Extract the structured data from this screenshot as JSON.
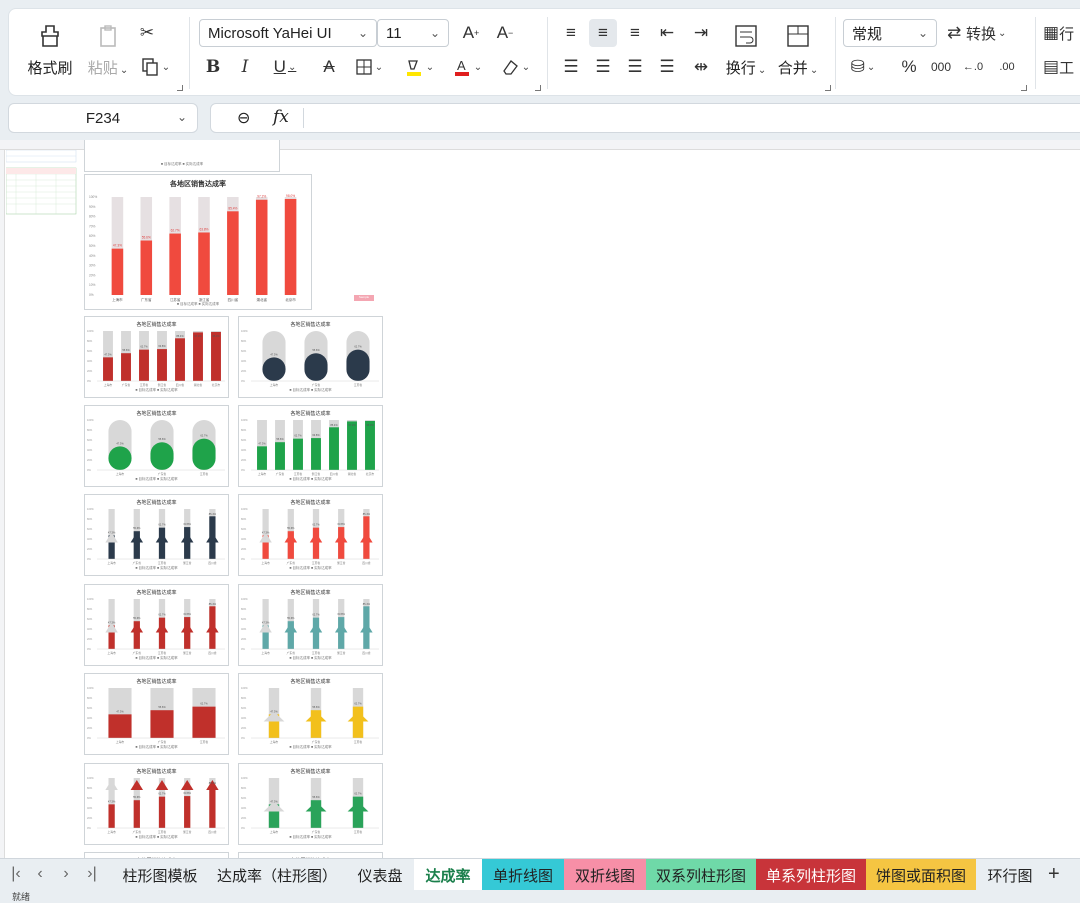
{
  "ribbon": {
    "format_painter": "格式刷",
    "paste": "粘贴",
    "font_name": "Microsoft YaHei UI",
    "font_size": "11",
    "wrap": "换行",
    "merge": "合并",
    "number_format": "常规",
    "convert": "转换",
    "row_col_partial": "行",
    "work_partial": "工",
    "percent_symbol": "%",
    "thousands_symbol": "000"
  },
  "formula_bar": {
    "cell_ref": "F234",
    "fx": "fx",
    "content": ""
  },
  "sheet": {
    "pink_chip": "Sample",
    "big_chart_title": "各地区销售达成率",
    "small_chart_title": "各地区销售达成率",
    "legend_text": "■ 目标达成率 ■ 实际达成率",
    "big_categories": [
      "上海市",
      "广东省",
      "江苏省",
      "浙江省",
      "四川省",
      "湖北省",
      "北京市"
    ],
    "big_values": [
      47.3,
      55.6,
      62.7,
      63.8,
      85.4,
      97.2,
      98.0
    ],
    "colors": {
      "accent_green": "#1a7f4b",
      "bar_red": "#f04a3e"
    }
  },
  "tabs": [
    {
      "label": "柱形图模板",
      "bg": "transparent",
      "color": "#222"
    },
    {
      "label": "达成率（柱形图）",
      "bg": "transparent",
      "color": "#222"
    },
    {
      "label": "仪表盘",
      "bg": "transparent",
      "color": "#222"
    },
    {
      "label": "达成率",
      "bg": "#ffffff",
      "color": "#1a7f4b"
    },
    {
      "label": "单折线图",
      "bg": "#35c9d6",
      "color": "#222"
    },
    {
      "label": "双折线图",
      "bg": "#f78fa7",
      "color": "#222"
    },
    {
      "label": "双系列柱形图",
      "bg": "#6fd9a8",
      "color": "#222"
    },
    {
      "label": "单系列柱形图",
      "bg": "#c8343a",
      "color": "#fff"
    },
    {
      "label": "饼图或面积图",
      "bg": "#f5c542",
      "color": "#222"
    },
    {
      "label": "环行图",
      "bg": "transparent",
      "color": "#222"
    }
  ],
  "status": {
    "left": "就绪"
  }
}
